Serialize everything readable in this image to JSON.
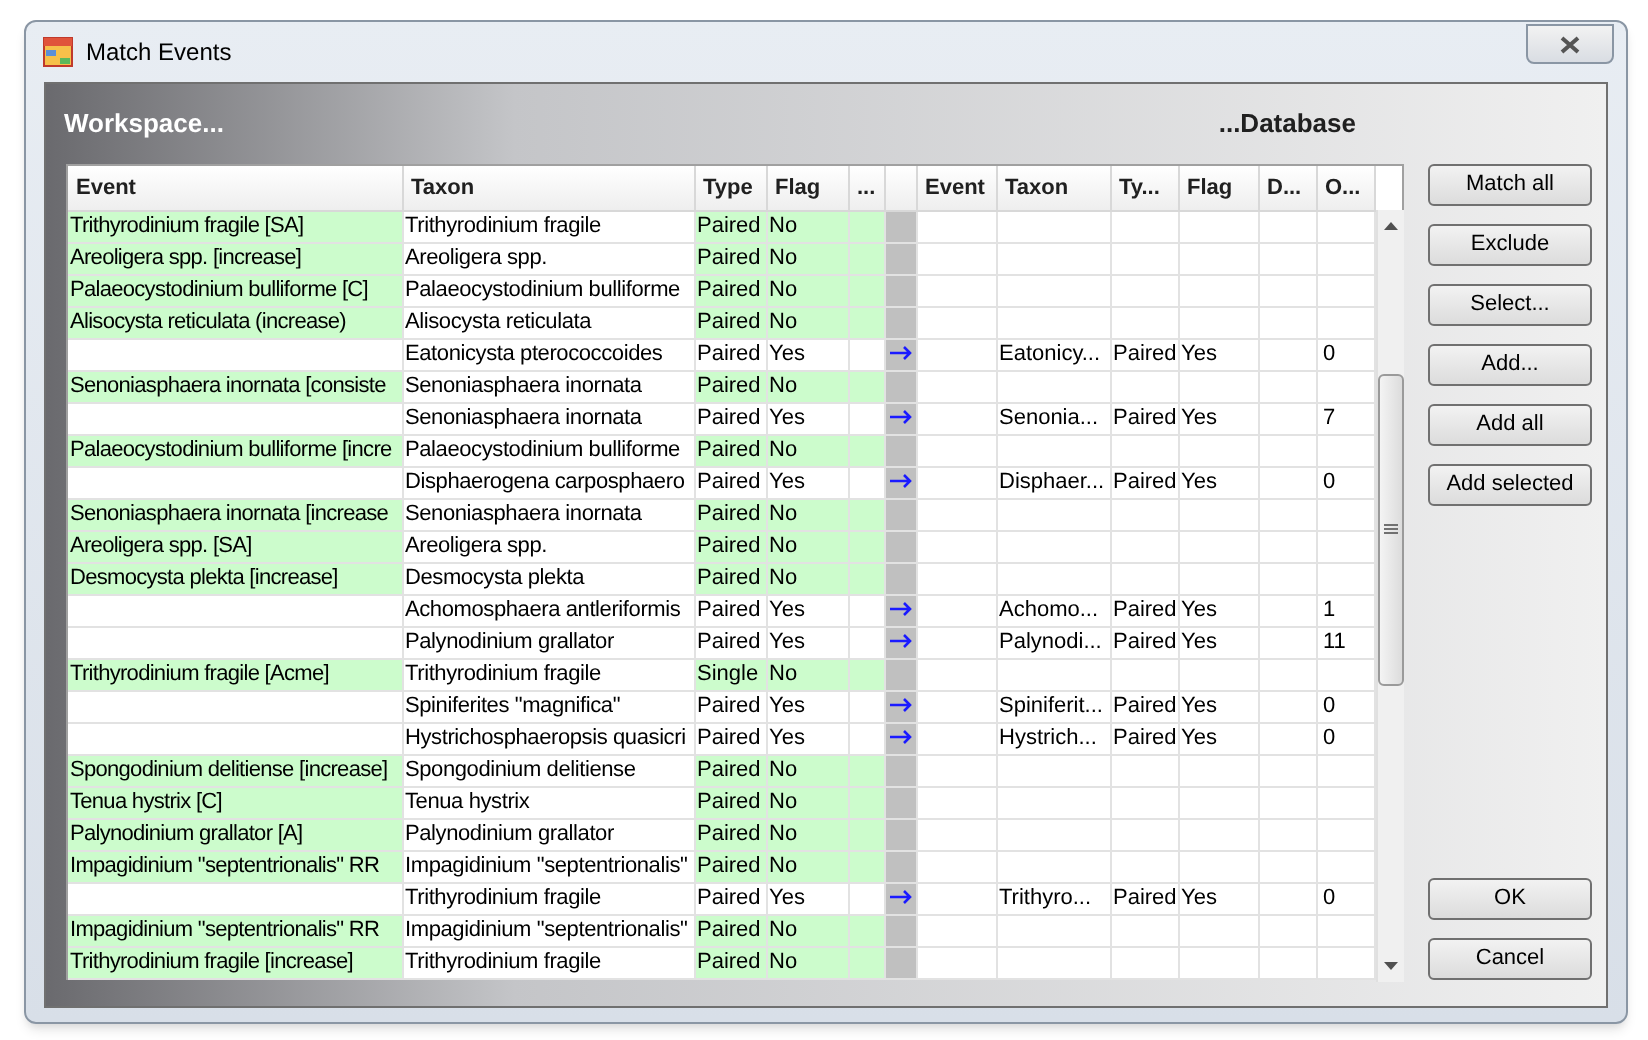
{
  "window": {
    "title": "Match Events"
  },
  "header": {
    "left": "Workspace...",
    "right": "...Database"
  },
  "table": {
    "columns": [
      "Event",
      "Taxon",
      "Type",
      "Flag",
      "...",
      "",
      "Event",
      "Taxon",
      "Ty...",
      "Flag",
      "D...",
      "O..."
    ],
    "rows": [
      {
        "highlighted": true,
        "event": "Trithyrodinium fragile [SA]",
        "taxon": "Trithyrodinium fragile",
        "type": "Paired",
        "flag": "No"
      },
      {
        "highlighted": true,
        "event": "Areoligera spp. [increase]",
        "taxon": "Areoligera spp.",
        "type": "Paired",
        "flag": "No"
      },
      {
        "highlighted": true,
        "event": "Palaeocystodinium bulliforme [C]",
        "taxon": "Palaeocystodinium bulliforme",
        "type": "Paired",
        "flag": "No"
      },
      {
        "highlighted": true,
        "event": "Alisocysta reticulata (increase)",
        "taxon": "Alisocysta reticulata",
        "type": "Paired",
        "flag": "No"
      },
      {
        "highlighted": false,
        "taxon": "Eatonicysta pterococcoides",
        "type": "Paired",
        "flag": "Yes",
        "database": {
          "taxon": "Eatonicy...",
          "type": "Paired",
          "flag": "Yes",
          "column_6": "0"
        }
      },
      {
        "highlighted": true,
        "event": "Senoniasphaera inornata [consiste",
        "taxon": "Senoniasphaera inornata",
        "type": "Paired",
        "flag": "No"
      },
      {
        "highlighted": false,
        "taxon": "Senoniasphaera inornata",
        "type": "Paired",
        "flag": "Yes",
        "database": {
          "taxon": "Senonia...",
          "type": "Paired",
          "flag": "Yes",
          "column_6": "7"
        }
      },
      {
        "highlighted": true,
        "event": "Palaeocystodinium bulliforme [incre",
        "taxon": "Palaeocystodinium bulliforme",
        "type": "Paired",
        "flag": "No"
      },
      {
        "highlighted": false,
        "taxon": "Disphaerogena carposphaero",
        "type": "Paired",
        "flag": "Yes",
        "database": {
          "taxon": "Disphaer...",
          "type": "Paired",
          "flag": "Yes",
          "column_6": "0"
        }
      },
      {
        "highlighted": true,
        "event": "Senoniasphaera inornata [increase",
        "taxon": "Senoniasphaera inornata",
        "type": "Paired",
        "flag": "No"
      },
      {
        "highlighted": true,
        "event": "Areoligera spp. [SA]",
        "taxon": "Areoligera spp.",
        "type": "Paired",
        "flag": "No"
      },
      {
        "highlighted": true,
        "event": "Desmocysta plekta [increase]",
        "taxon": "Desmocysta plekta",
        "type": "Paired",
        "flag": "No"
      },
      {
        "highlighted": false,
        "taxon": "Achomosphaera antleriformis",
        "type": "Paired",
        "flag": "Yes",
        "database": {
          "taxon": "Achomo...",
          "type": "Paired",
          "flag": "Yes",
          "column_6": "1"
        }
      },
      {
        "highlighted": false,
        "taxon": "Palynodinium grallator",
        "type": "Paired",
        "flag": "Yes",
        "database": {
          "taxon": "Palynodi...",
          "type": "Paired",
          "flag": "Yes",
          "column_6": "11"
        }
      },
      {
        "highlighted": true,
        "event": "Trithyrodinium fragile [Acme]",
        "taxon": "Trithyrodinium fragile",
        "type": "Single",
        "flag": "No"
      },
      {
        "highlighted": false,
        "taxon": "Spiniferites \"magnifica\"",
        "type": "Paired",
        "flag": "Yes",
        "database": {
          "taxon": "Spiniferit...",
          "type": "Paired",
          "flag": "Yes",
          "column_6": "0"
        }
      },
      {
        "highlighted": false,
        "taxon": "Hystrichosphaeropsis quasicri",
        "type": "Paired",
        "flag": "Yes",
        "database": {
          "taxon": "Hystrich...",
          "type": "Paired",
          "flag": "Yes",
          "column_6": "0"
        }
      },
      {
        "highlighted": true,
        "event": "Spongodinium delitiense [increase]",
        "taxon": "Spongodinium delitiense",
        "type": "Paired",
        "flag": "No"
      },
      {
        "highlighted": true,
        "event": "Tenua hystrix [C]",
        "taxon": "Tenua hystrix",
        "type": "Paired",
        "flag": "No"
      },
      {
        "highlighted": true,
        "event": "Palynodinium grallator [A]",
        "taxon": "Palynodinium grallator",
        "type": "Paired",
        "flag": "No"
      },
      {
        "highlighted": true,
        "event": "Impagidinium \"septentrionalis\"  RR",
        "taxon": "Impagidinium \"septentrionalis\"",
        "type": "Paired",
        "flag": "No"
      },
      {
        "highlighted": false,
        "taxon": "Trithyrodinium fragile",
        "type": "Paired",
        "flag": "Yes",
        "database": {
          "taxon": "Trithyro...",
          "type": "Paired",
          "flag": "Yes",
          "column_6": "0"
        }
      },
      {
        "highlighted": true,
        "event": "Impagidinium \"septentrionalis\"  RR",
        "taxon": "Impagidinium \"septentrionalis\"",
        "type": "Paired",
        "flag": "No"
      },
      {
        "highlighted": true,
        "event": "Trithyrodinium fragile [increase]",
        "taxon": "Trithyrodinium fragile",
        "type": "Paired",
        "flag": "No"
      }
    ]
  },
  "side_buttons": [
    "Match all",
    "Exclude",
    "Select...",
    "Add...",
    "Add all",
    "Add selected"
  ],
  "dialog_buttons": [
    "OK",
    "Cancel"
  ]
}
